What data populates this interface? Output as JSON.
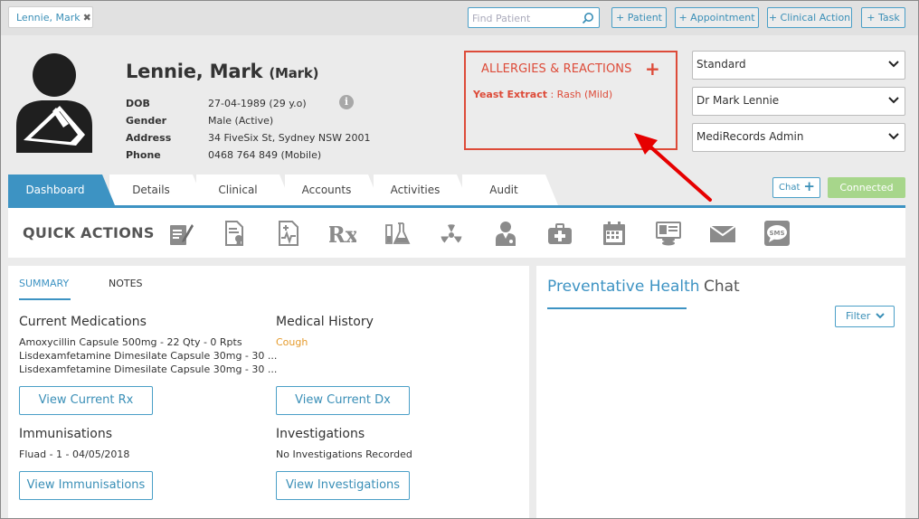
{
  "topbar": {
    "patient_tab": "Lennie, Mark",
    "close_glyph": "✖",
    "search_placeholder": "Find Patient",
    "buttons": [
      "+ Patient",
      "+ Appointment",
      "+ Clinical Action",
      "+ Task"
    ]
  },
  "patient": {
    "name": "Lennie, Mark",
    "preferred": "(Mark)",
    "fields": [
      {
        "label": "DOB",
        "value": "27-04-1989 (29 y.o)"
      },
      {
        "label": "Gender",
        "value": "Male (Active)"
      },
      {
        "label": "Address",
        "value": "34 FiveSix St, Sydney NSW 2001"
      },
      {
        "label": "Phone",
        "value": "0468 764 849 (Mobile)"
      }
    ],
    "info_glyph": "i"
  },
  "allergies": {
    "title": "ALLERGIES & REACTIONS",
    "add_glyph": "+",
    "item_name": "Yeast Extract",
    "item_reaction": ": Rash (Mild)"
  },
  "selects": [
    "Standard",
    "Dr Mark Lennie",
    "MediRecords Admin"
  ],
  "tabs": [
    "Dashboard",
    "Details",
    "Clinical",
    "Accounts",
    "Activities",
    "Audit"
  ],
  "active_tab": "Dashboard",
  "chat_button": {
    "label": "Chat",
    "glyph": "+"
  },
  "connection_status": "Connected",
  "quick_actions": {
    "label": "QUICK ACTIONS",
    "icons": [
      "note-edit-icon",
      "certificate-icon",
      "medical-report-icon",
      "rx-prescription-icon",
      "lab-flask-icon",
      "radiation-icon",
      "doctor-referral-icon",
      "medical-kit-icon",
      "calendar-icon",
      "billing-icon",
      "mail-icon",
      "sms-icon"
    ],
    "rx_text": "Rx",
    "sms_text": "SMS"
  },
  "summary": {
    "tabs": [
      "SUMMARY",
      "NOTES"
    ],
    "medications": {
      "title": "Current Medications",
      "items": [
        "Amoxycillin Capsule 500mg - 22 Qty - 0 Rpts",
        "Lisdexamfetamine Dimesilate Capsule 30mg - 30 ...",
        "Lisdexamfetamine Dimesilate Capsule 30mg - 30 ..."
      ],
      "button": "View Current Rx"
    },
    "history": {
      "title": "Medical History",
      "items": [
        "Cough"
      ],
      "button": "View Current Dx"
    },
    "immunisations": {
      "title": "Immunisations",
      "items": [
        "Fluad - 1 - 04/05/2018"
      ],
      "button": "View Immunisations"
    },
    "investigations": {
      "title": "Investigations",
      "items": [
        "No Investigations Recorded"
      ],
      "button": "View Investigations"
    }
  },
  "right_panel": {
    "tabs": [
      "Preventative Health",
      "Chat"
    ],
    "filter": "Filter"
  },
  "colors": {
    "accent": "#3d93c3",
    "allergy": "#dd4b39",
    "connected": "#a7d68b",
    "history_item": "#e59a2b"
  }
}
